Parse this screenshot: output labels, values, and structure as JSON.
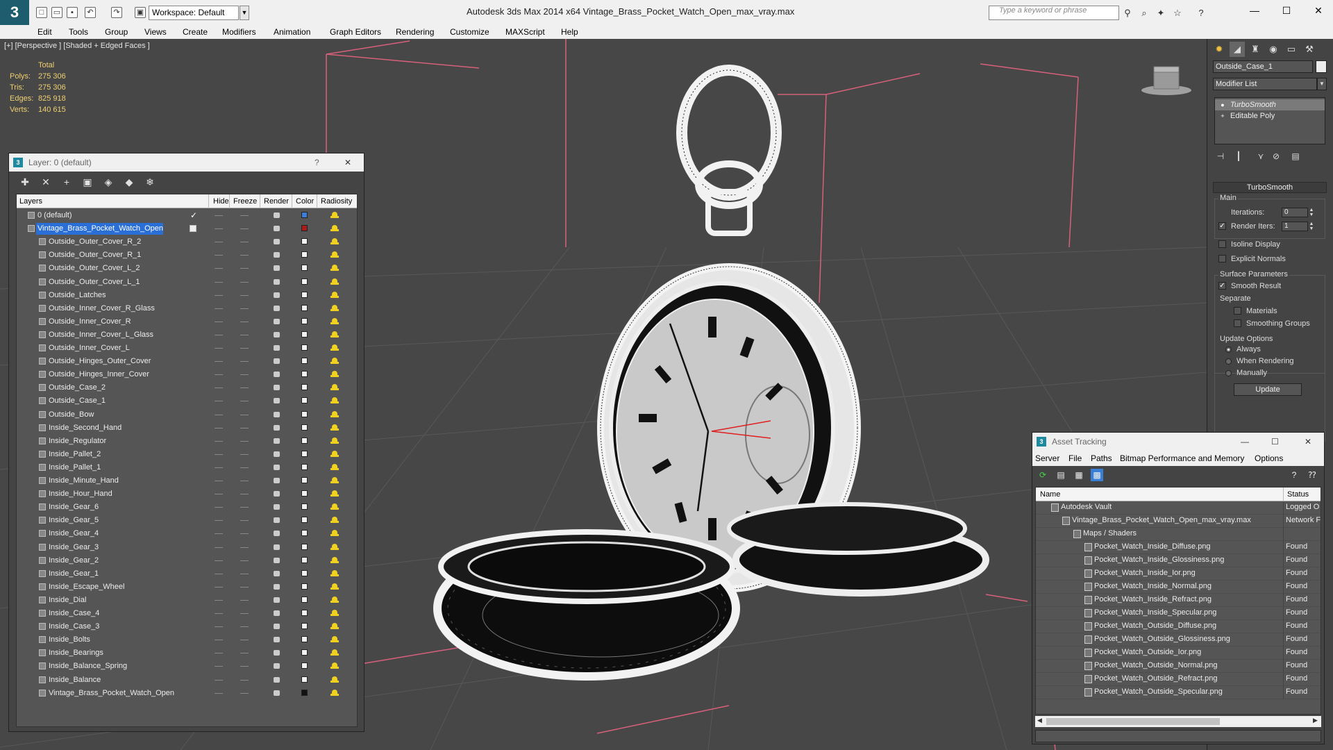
{
  "app": {
    "logo_text": "3",
    "workspace": "Workspace: Default",
    "title": "Autodesk 3ds Max  2014 x64      Vintage_Brass_Pocket_Watch_Open_max_vray.max",
    "search_placeholder": "Type a keyword or phrase",
    "minimize": "—",
    "maximize": "☐",
    "close": "✕"
  },
  "menu": [
    "Edit",
    "Tools",
    "Group",
    "Views",
    "Create",
    "Modifiers",
    "Animation",
    "Graph Editors",
    "Rendering",
    "Customize",
    "MAXScript",
    "Help"
  ],
  "viewport": {
    "label": "[+] [Perspective ] [Shaded + Edged Faces ]",
    "stats_header": "Total",
    "stats": [
      {
        "label": "Polys:",
        "value": "275 306"
      },
      {
        "label": "Tris:",
        "value": "275 306"
      },
      {
        "label": "Edges:",
        "value": "825 918"
      },
      {
        "label": "Verts:",
        "value": "140 615"
      }
    ]
  },
  "layer_manager": {
    "title": "Layer: 0 (default)",
    "help": "?",
    "close": "✕",
    "columns": [
      "Layers",
      "Hide",
      "Freeze",
      "Render",
      "Color",
      "Radiosity"
    ],
    "rows": [
      {
        "name": "0 (default)",
        "indent": 1,
        "color": "#3b7dd8",
        "check": "✓"
      },
      {
        "name": "Vintage_Brass_Pocket_Watch_Open",
        "indent": 1,
        "color": "#aa1c1c",
        "selected": true
      },
      {
        "name": "Outside_Outer_Cover_R_2",
        "indent": 2,
        "color": "#f2f2f2"
      },
      {
        "name": "Outside_Outer_Cover_R_1",
        "indent": 2,
        "color": "#f2f2f2"
      },
      {
        "name": "Outside_Outer_Cover_L_2",
        "indent": 2,
        "color": "#f2f2f2"
      },
      {
        "name": "Outside_Outer_Cover_L_1",
        "indent": 2,
        "color": "#f2f2f2"
      },
      {
        "name": "Outside_Latches",
        "indent": 2,
        "color": "#f2f2f2"
      },
      {
        "name": "Outside_Inner_Cover_R_Glass",
        "indent": 2,
        "color": "#f2f2f2"
      },
      {
        "name": "Outside_Inner_Cover_R",
        "indent": 2,
        "color": "#f2f2f2"
      },
      {
        "name": "Outside_Inner_Cover_L_Glass",
        "indent": 2,
        "color": "#f2f2f2"
      },
      {
        "name": "Outside_Inner_Cover_L",
        "indent": 2,
        "color": "#f2f2f2"
      },
      {
        "name": "Outside_Hinges_Outer_Cover",
        "indent": 2,
        "color": "#f2f2f2"
      },
      {
        "name": "Outside_Hinges_Inner_Cover",
        "indent": 2,
        "color": "#f2f2f2"
      },
      {
        "name": "Outside_Case_2",
        "indent": 2,
        "color": "#f2f2f2"
      },
      {
        "name": "Outside_Case_1",
        "indent": 2,
        "color": "#f2f2f2"
      },
      {
        "name": "Outside_Bow",
        "indent": 2,
        "color": "#f2f2f2"
      },
      {
        "name": "Inside_Second_Hand",
        "indent": 2,
        "color": "#f2f2f2"
      },
      {
        "name": "Inside_Regulator",
        "indent": 2,
        "color": "#f2f2f2"
      },
      {
        "name": "Inside_Pallet_2",
        "indent": 2,
        "color": "#f2f2f2"
      },
      {
        "name": "Inside_Pallet_1",
        "indent": 2,
        "color": "#f2f2f2"
      },
      {
        "name": "Inside_Minute_Hand",
        "indent": 2,
        "color": "#f2f2f2"
      },
      {
        "name": "Inside_Hour_Hand",
        "indent": 2,
        "color": "#f2f2f2"
      },
      {
        "name": "Inside_Gear_6",
        "indent": 2,
        "color": "#f2f2f2"
      },
      {
        "name": "Inside_Gear_5",
        "indent": 2,
        "color": "#f2f2f2"
      },
      {
        "name": "Inside_Gear_4",
        "indent": 2,
        "color": "#f2f2f2"
      },
      {
        "name": "Inside_Gear_3",
        "indent": 2,
        "color": "#f2f2f2"
      },
      {
        "name": "Inside_Gear_2",
        "indent": 2,
        "color": "#f2f2f2"
      },
      {
        "name": "Inside_Gear_1",
        "indent": 2,
        "color": "#f2f2f2"
      },
      {
        "name": "Inside_Escape_Wheel",
        "indent": 2,
        "color": "#f2f2f2"
      },
      {
        "name": "Inside_Dial",
        "indent": 2,
        "color": "#f2f2f2"
      },
      {
        "name": "Inside_Case_4",
        "indent": 2,
        "color": "#f2f2f2"
      },
      {
        "name": "Inside_Case_3",
        "indent": 2,
        "color": "#f2f2f2"
      },
      {
        "name": "Inside_Bolts",
        "indent": 2,
        "color": "#f2f2f2"
      },
      {
        "name": "Inside_Bearings",
        "indent": 2,
        "color": "#f2f2f2"
      },
      {
        "name": "Inside_Balance_Spring",
        "indent": 2,
        "color": "#f2f2f2"
      },
      {
        "name": "Inside_Balance",
        "indent": 2,
        "color": "#f2f2f2"
      },
      {
        "name": "Vintage_Brass_Pocket_Watch_Open",
        "indent": 2,
        "color": "#111111"
      }
    ]
  },
  "command_panel": {
    "object_name": "Outside_Case_1",
    "modifier_list": "Modifier List",
    "stack": [
      "TurboSmooth",
      "Editable Poly"
    ],
    "rollout_title": "TurboSmooth",
    "main_group": "Main",
    "iterations_label": "Iterations:",
    "iterations_value": "0",
    "render_iters_label": "Render Iters:",
    "render_iters_value": "1",
    "isoline_display": "Isoline Display",
    "explicit_normals": "Explicit Normals",
    "surface_group": "Surface Parameters",
    "smooth_result": "Smooth Result",
    "separate_label": "Separate",
    "materials": "Materials",
    "smoothing_groups": "Smoothing Groups",
    "update_group": "Update Options",
    "always": "Always",
    "when_rendering": "When Rendering",
    "manually": "Manually",
    "update_button": "Update",
    "check_mark": "✓"
  },
  "asset_tracking": {
    "title": "Asset Tracking",
    "menu": [
      "Server",
      "File",
      "Paths",
      "Bitmap Performance and Memory",
      "Options"
    ],
    "col_name": "Name",
    "col_status": "Status",
    "rows": [
      {
        "name": "Autodesk Vault",
        "indent": 0,
        "status": "Logged O"
      },
      {
        "name": "Vintage_Brass_Pocket_Watch_Open_max_vray.max",
        "indent": 1,
        "status": "Network F"
      },
      {
        "name": "Maps / Shaders",
        "indent": 2,
        "status": ""
      },
      {
        "name": "Pocket_Watch_Inside_Diffuse.png",
        "indent": 3,
        "status": "Found"
      },
      {
        "name": "Pocket_Watch_Inside_Glossiness.png",
        "indent": 3,
        "status": "Found"
      },
      {
        "name": "Pocket_Watch_Inside_Ior.png",
        "indent": 3,
        "status": "Found"
      },
      {
        "name": "Pocket_Watch_Inside_Normal.png",
        "indent": 3,
        "status": "Found"
      },
      {
        "name": "Pocket_Watch_Inside_Refract.png",
        "indent": 3,
        "status": "Found"
      },
      {
        "name": "Pocket_Watch_Inside_Specular.png",
        "indent": 3,
        "status": "Found"
      },
      {
        "name": "Pocket_Watch_Outside_Diffuse.png",
        "indent": 3,
        "status": "Found"
      },
      {
        "name": "Pocket_Watch_Outside_Glossiness.png",
        "indent": 3,
        "status": "Found"
      },
      {
        "name": "Pocket_Watch_Outside_Ior.png",
        "indent": 3,
        "status": "Found"
      },
      {
        "name": "Pocket_Watch_Outside_Normal.png",
        "indent": 3,
        "status": "Found"
      },
      {
        "name": "Pocket_Watch_Outside_Refract.png",
        "indent": 3,
        "status": "Found"
      },
      {
        "name": "Pocket_Watch_Outside_Specular.png",
        "indent": 3,
        "status": "Found"
      }
    ]
  },
  "colors": {
    "selection": "#2a6fd6",
    "stats_text": "#f0d070",
    "grid_pink": "#d8607a",
    "viewport_bg": "#474747"
  }
}
